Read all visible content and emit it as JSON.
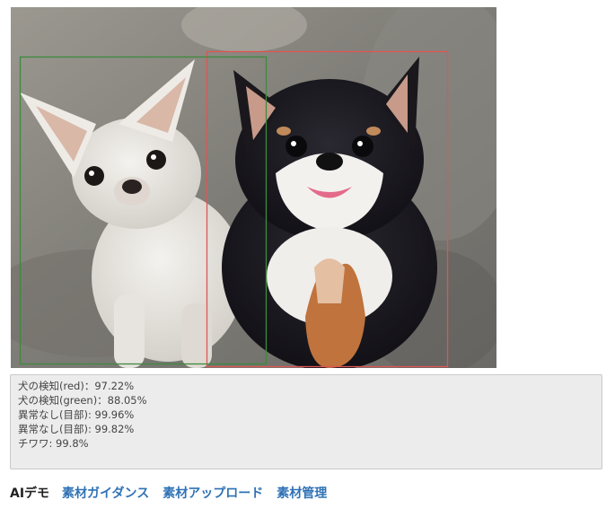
{
  "detection": {
    "boxes": [
      {
        "label": "red",
        "color": "#e05555"
      },
      {
        "label": "green",
        "color": "#3e8a3e"
      }
    ],
    "results": [
      "犬の検知(red)：97.22%",
      "犬の検知(green)：88.05%",
      "異常なし(目部): 99.96%",
      "異常なし(目部): 99.82%",
      "チワワ: 99.8%"
    ]
  },
  "nav": {
    "brand": "AIデモ",
    "links": [
      "素材ガイダンス",
      "素材アップロード",
      "素材管理"
    ],
    "link_color": "#2f72b5"
  }
}
